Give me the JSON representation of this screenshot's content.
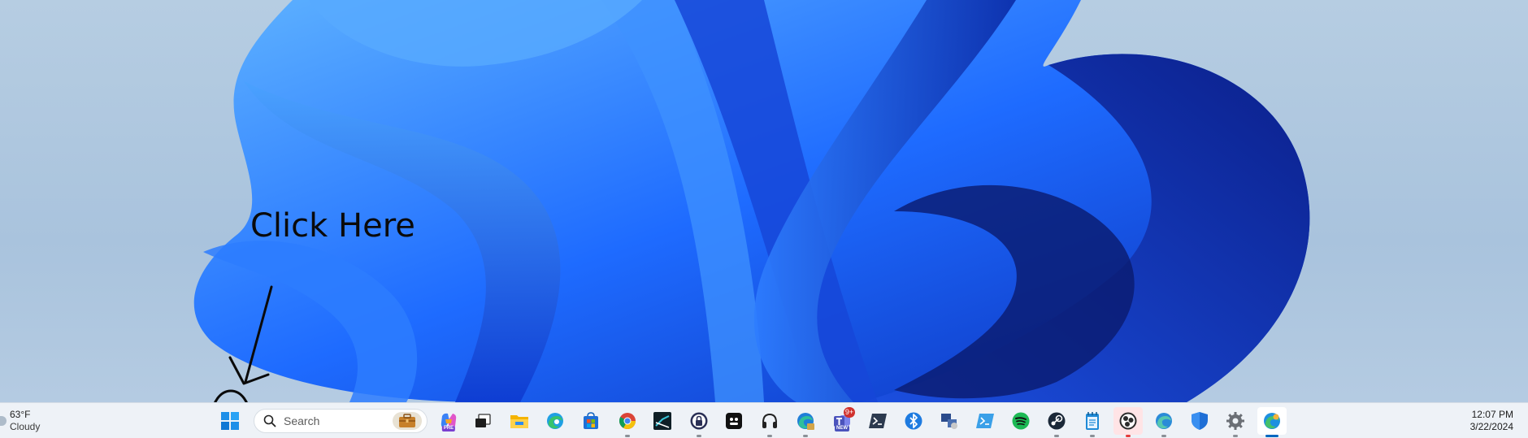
{
  "annotation": {
    "text": "Click Here"
  },
  "weather": {
    "temperature": "63°F",
    "condition": "Cloudy"
  },
  "search": {
    "label": "Search"
  },
  "taskbar_apps": [
    {
      "name": "copilot-icon",
      "tag": "PRE"
    },
    {
      "name": "task-view-icon"
    },
    {
      "name": "file-explorer-icon"
    },
    {
      "name": "edge-icon"
    },
    {
      "name": "microsoft-store-icon"
    },
    {
      "name": "chrome-icon"
    },
    {
      "name": "capcut-icon"
    },
    {
      "name": "password-manager-icon"
    },
    {
      "name": "app-dots-icon"
    },
    {
      "name": "headset-icon"
    },
    {
      "name": "edge-beta-icon"
    },
    {
      "name": "teams-icon",
      "badge": "9+",
      "tag": "NEW"
    },
    {
      "name": "terminal-icon"
    },
    {
      "name": "bluetooth-icon"
    },
    {
      "name": "network-app-icon"
    },
    {
      "name": "powershell-icon"
    },
    {
      "name": "spotify-icon"
    },
    {
      "name": "steam-icon"
    },
    {
      "name": "notepad-icon"
    },
    {
      "name": "obs-icon"
    },
    {
      "name": "edge-dev-icon"
    },
    {
      "name": "windows-security-icon"
    },
    {
      "name": "settings-gear-icon"
    },
    {
      "name": "edge-canary-icon"
    }
  ],
  "clock": {
    "time": "12:07 PM",
    "date": "3/22/2024"
  },
  "colors": {
    "taskbar": "#eef2f7",
    "accent": "#0067c0",
    "wallpaper_blue": "#1a5cf0"
  }
}
